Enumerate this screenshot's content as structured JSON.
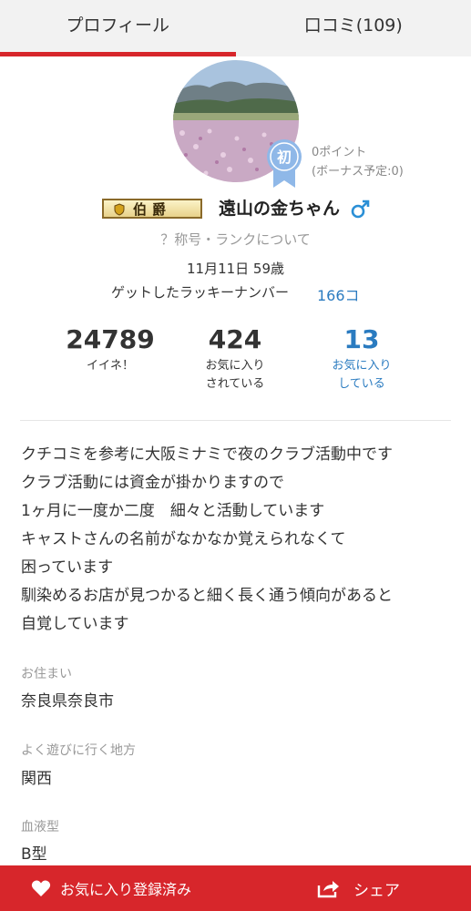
{
  "tabs": [
    {
      "label": "プロフィール",
      "active": true
    },
    {
      "label": "口コミ(109)",
      "active": false
    }
  ],
  "profile": {
    "badge_text": "初",
    "points": "0ポイント",
    "bonus": "(ボーナス予定:0)",
    "rank_title": "伯爵",
    "username": "遠山の金ちゃん",
    "gender_icon": "male-icon",
    "rank_link": "？称号・ランクについて",
    "birth_age": "11月11日 59歳",
    "lucky_label": "ゲットしたラッキーナンバー",
    "lucky_value": "166コ"
  },
  "stats": [
    {
      "value": "24789",
      "label": "イイネ！"
    },
    {
      "value": "424",
      "label": "お気に入り\nされている"
    },
    {
      "value": "13",
      "label": "お気に入り\nしている"
    }
  ],
  "bio": [
    "クチコミを参考に大阪ミナミで夜のクラブ活動中です",
    "クラブ活動には資金が掛かりますので",
    "1ヶ月に一度か二度　細々と活動しています",
    "キャストさんの名前がなかなか覚えられなくて",
    "困っています",
    "馴染めるお店が見つかると細く長く通う傾向があると",
    "自覚しています"
  ],
  "info": {
    "residence_label": "お住まい",
    "residence_value": "奈良県奈良市",
    "area_label": "よく遊びに行く地方",
    "area_value": "関西",
    "blood_label": "血液型",
    "blood_value": "B型"
  },
  "footer": {
    "favorite_label": "お気に入り登録済み",
    "share_label": "シェア"
  },
  "colors": {
    "accent": "#d7262b",
    "link": "#2a7bc0"
  }
}
